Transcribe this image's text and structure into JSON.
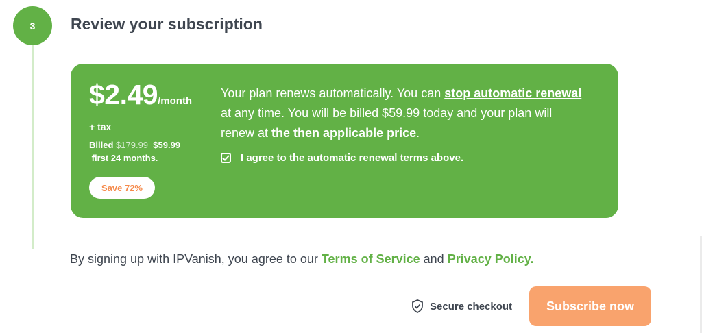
{
  "step": {
    "number": "3",
    "title": "Review your subscription"
  },
  "plan": {
    "price": "$2.49",
    "period": "/month",
    "tax_note": "+ tax",
    "billed_label": "Billed",
    "original_price": "$179.99",
    "billed_price": "$59.99",
    "term": "first 24 months.",
    "save_badge": "Save 72%",
    "renewal": {
      "text_1": "Your plan renews automatically. You can ",
      "link_stop": "stop automatic renewal",
      "text_2": " at any time.  You will be billed $59.99 today and your plan will renew at ",
      "link_price": "the then applicable price",
      "text_3": "."
    },
    "agree_label": "I agree to the automatic renewal terms above.",
    "agree_checked": true
  },
  "terms": {
    "text_1": "By signing up with IPVanish, you agree to our ",
    "tos_link": "Terms of Service",
    "text_2": " and ",
    "privacy_link": "Privacy Policy."
  },
  "checkout": {
    "secure_label": "Secure checkout",
    "secure_icon": "shield-check-icon",
    "subscribe_label": "Subscribe now"
  },
  "colors": {
    "brand_green": "#62b146",
    "accent_orange": "#f9a36d",
    "badge_orange": "#f58a4b",
    "text_dark": "#3f4650"
  }
}
